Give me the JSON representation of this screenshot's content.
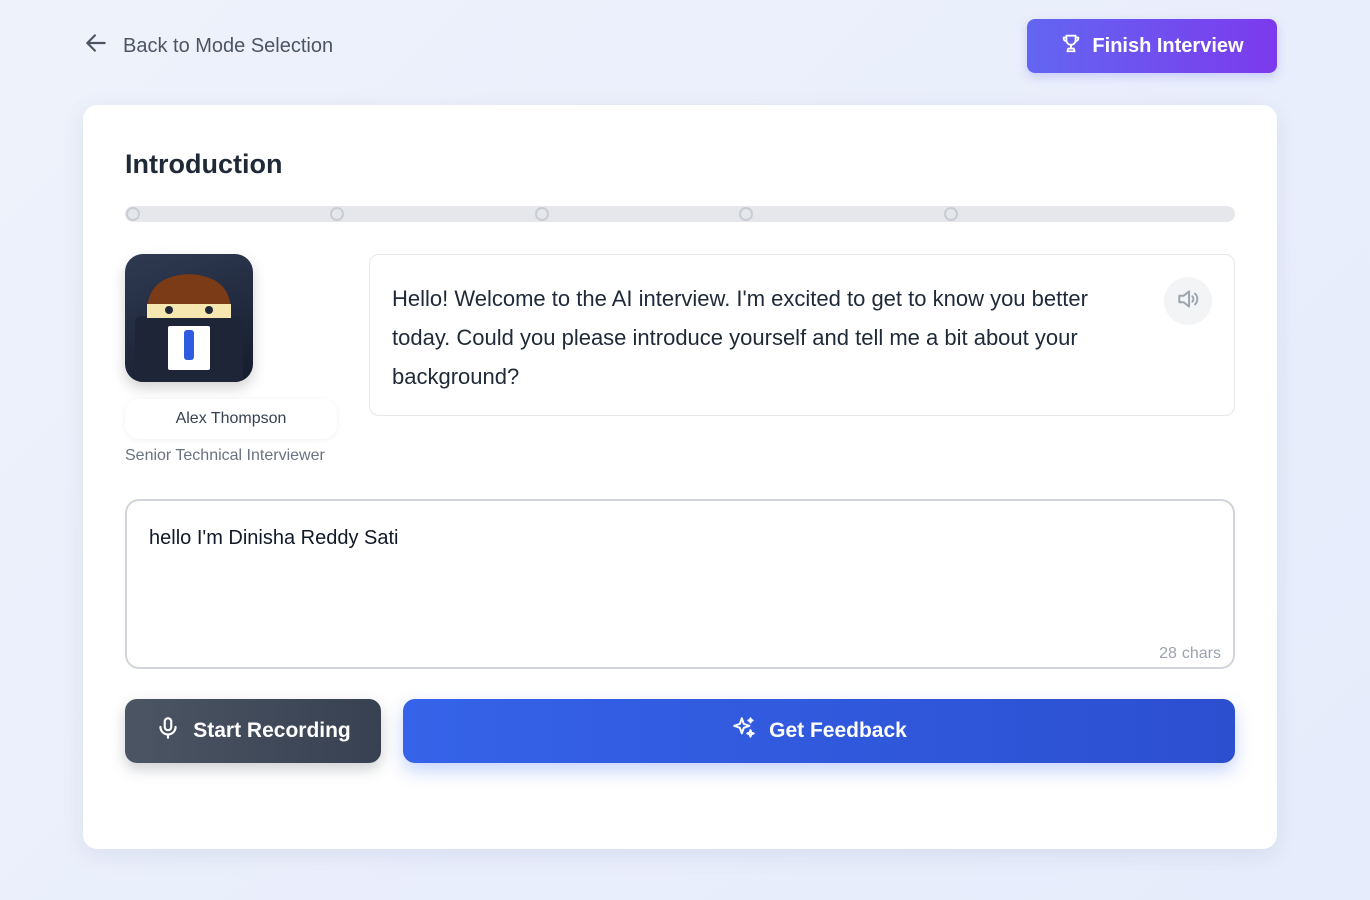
{
  "header": {
    "back_label": "Back to Mode Selection",
    "finish_label": "Finish Interview"
  },
  "stage": {
    "title": "Introduction",
    "progress_steps": 5,
    "progress_fraction": 0.0
  },
  "interviewer": {
    "name": "Alex Thompson",
    "role": "Senior Technical Interviewer"
  },
  "question": {
    "text": "Hello! Welcome to the AI interview. I'm excited to get to know you better today. Could you please introduce yourself and tell me a bit about your background?"
  },
  "answer": {
    "value": "hello I'm Dinisha Reddy Sati",
    "char_count": "28",
    "char_unit": "chars"
  },
  "actions": {
    "record_label": "Start Recording",
    "feedback_label": "Get Feedback"
  },
  "colors": {
    "finish_gradient_start": "#6366f1",
    "finish_gradient_end": "#7c3aed",
    "feedback_primary": "#3563e9",
    "record_primary": "#4b5563"
  },
  "icons": {
    "back": "arrow-left-icon",
    "finish": "trophy-icon",
    "speaker": "volume-icon",
    "record": "microphone-icon",
    "feedback": "sparkles-icon"
  }
}
